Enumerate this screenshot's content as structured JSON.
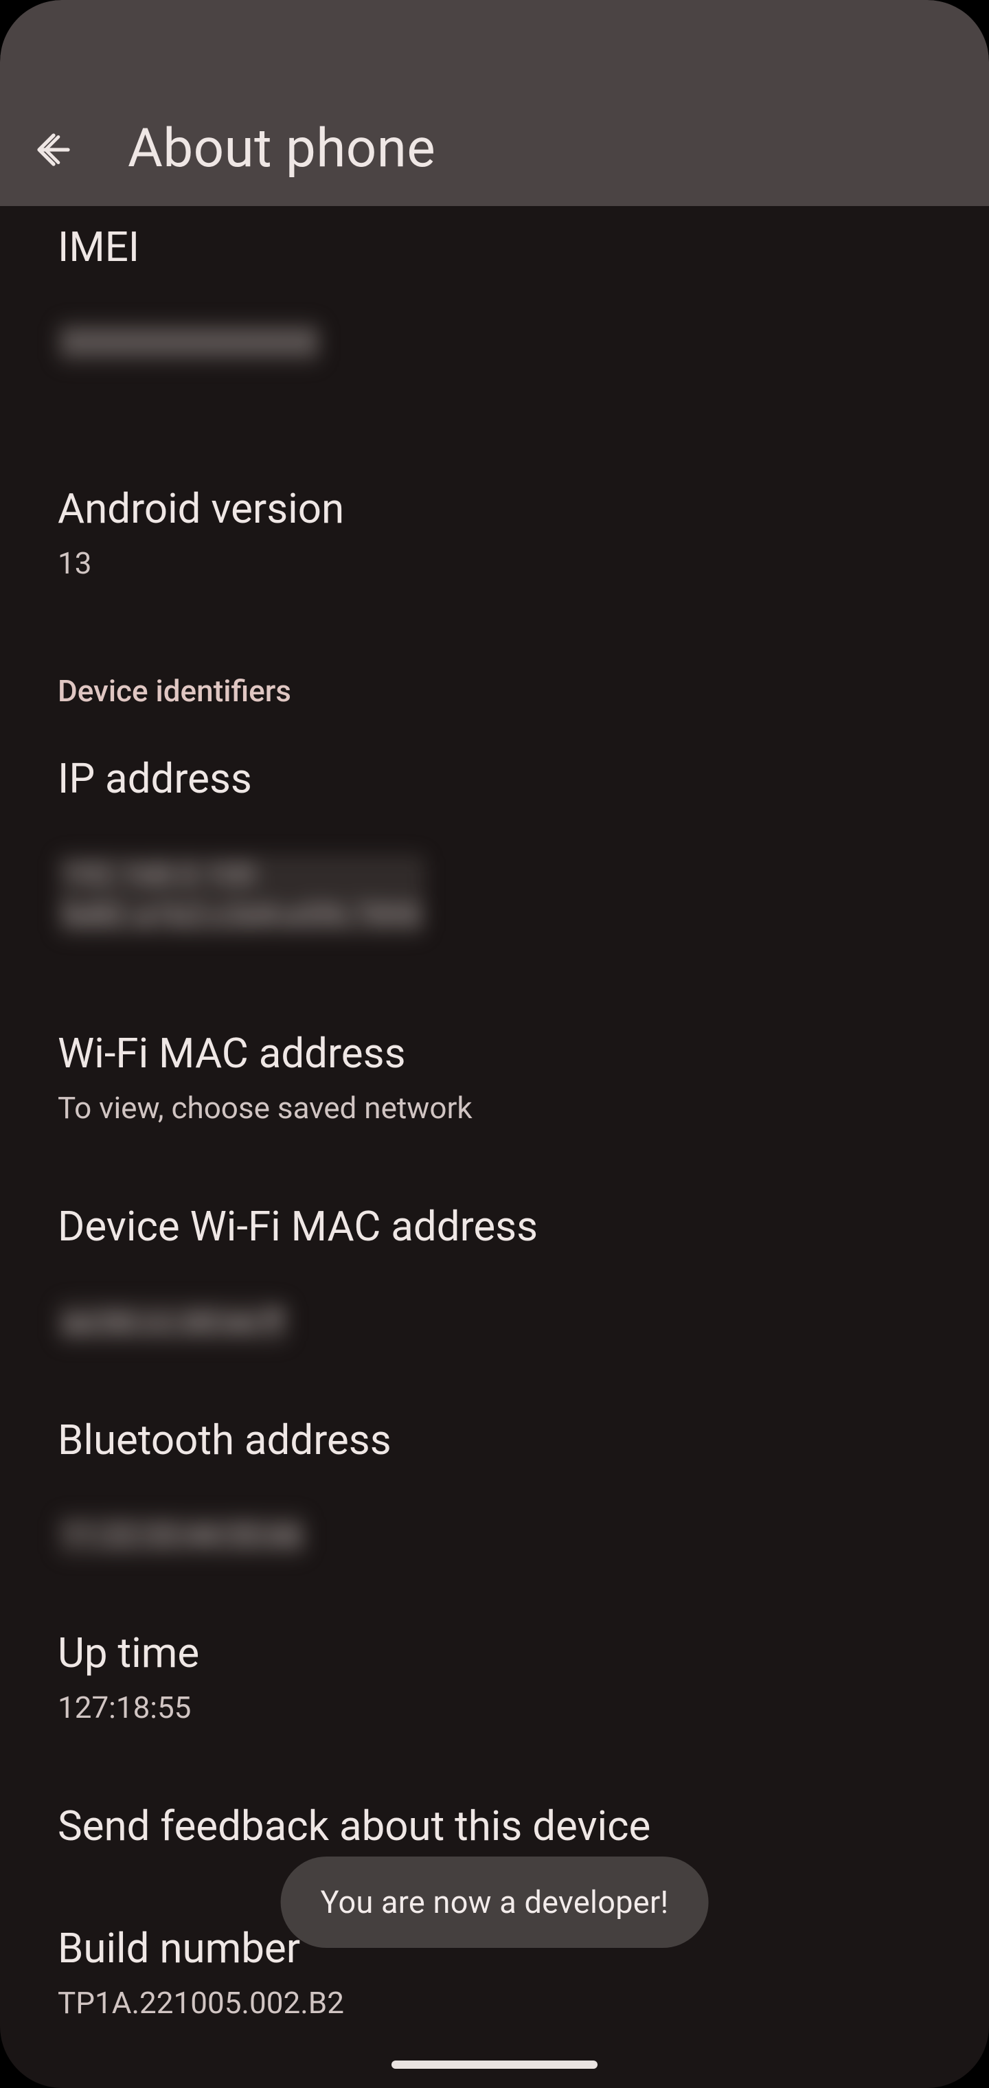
{
  "header": {
    "title": "About phone"
  },
  "items": {
    "imei": {
      "title": "IMEI",
      "value": "000000000000000"
    },
    "android_version": {
      "title": "Android version",
      "value": "13"
    },
    "section_device_identifiers": "Device identifiers",
    "ip_address": {
      "title": "IP address",
      "value": "192.168.0.100\nfe80::a1b2:c3d4:e5f6:7890"
    },
    "wifi_mac": {
      "title": "Wi-Fi MAC address",
      "value": "To view, choose saved network"
    },
    "device_wifi_mac": {
      "title": "Device Wi-Fi MAC address",
      "value": "aa:bb:cc:dd:ee:ff"
    },
    "bt_address": {
      "title": "Bluetooth address",
      "value": "11:22:33:44:55:66"
    },
    "uptime": {
      "title": "Up time",
      "value": "127:18:55"
    },
    "feedback": {
      "title": "Send feedback about this device"
    },
    "build": {
      "title": "Build number",
      "value": "TP1A.221005.002.B2"
    }
  },
  "toast": {
    "text": "You are now a developer!"
  }
}
